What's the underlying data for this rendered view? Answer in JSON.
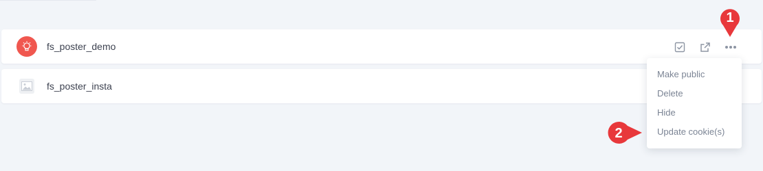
{
  "accounts": [
    {
      "name": "fs_poster_demo",
      "avatar": "bulb-avatar-icon"
    },
    {
      "name": "fs_poster_insta",
      "avatar": "image-placeholder-icon"
    }
  ],
  "actions": [
    "checkbox-icon",
    "external-link-icon",
    "more-dots-icon"
  ],
  "menu": {
    "items": [
      "Make public",
      "Delete",
      "Hide",
      "Update cookie(s)"
    ]
  },
  "annotations": {
    "marker1": "1",
    "marker2": "2"
  },
  "colors": {
    "accent": "#f0574f",
    "marker": "#e8383b",
    "background": "#f2f5f9"
  }
}
